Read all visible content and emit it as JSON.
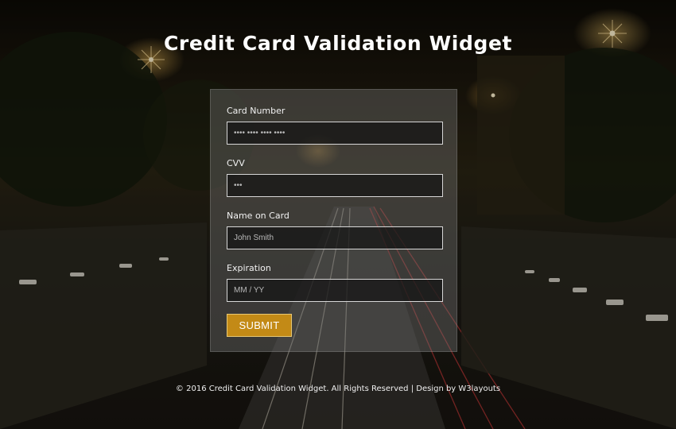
{
  "page": {
    "title": "Credit Card Validation Widget"
  },
  "form": {
    "card_number": {
      "label": "Card Number",
      "placeholder": "•••• •••• •••• ••••"
    },
    "cvv": {
      "label": "CVV",
      "placeholder": "•••"
    },
    "name": {
      "label": "Name on Card",
      "placeholder": "John Smith"
    },
    "expiration": {
      "label": "Expiration",
      "placeholder": "MM / YY"
    },
    "submit_label": "SUBMIT"
  },
  "footer": {
    "text": "© 2016 Credit Card Validation Widget. All Rights Reserved | Design by ",
    "link_text": "W3layouts"
  },
  "colors": {
    "accent": "#c38a16",
    "card_bg": "rgba(120,120,120,0.38)",
    "field_border": "#d7d7d7"
  }
}
